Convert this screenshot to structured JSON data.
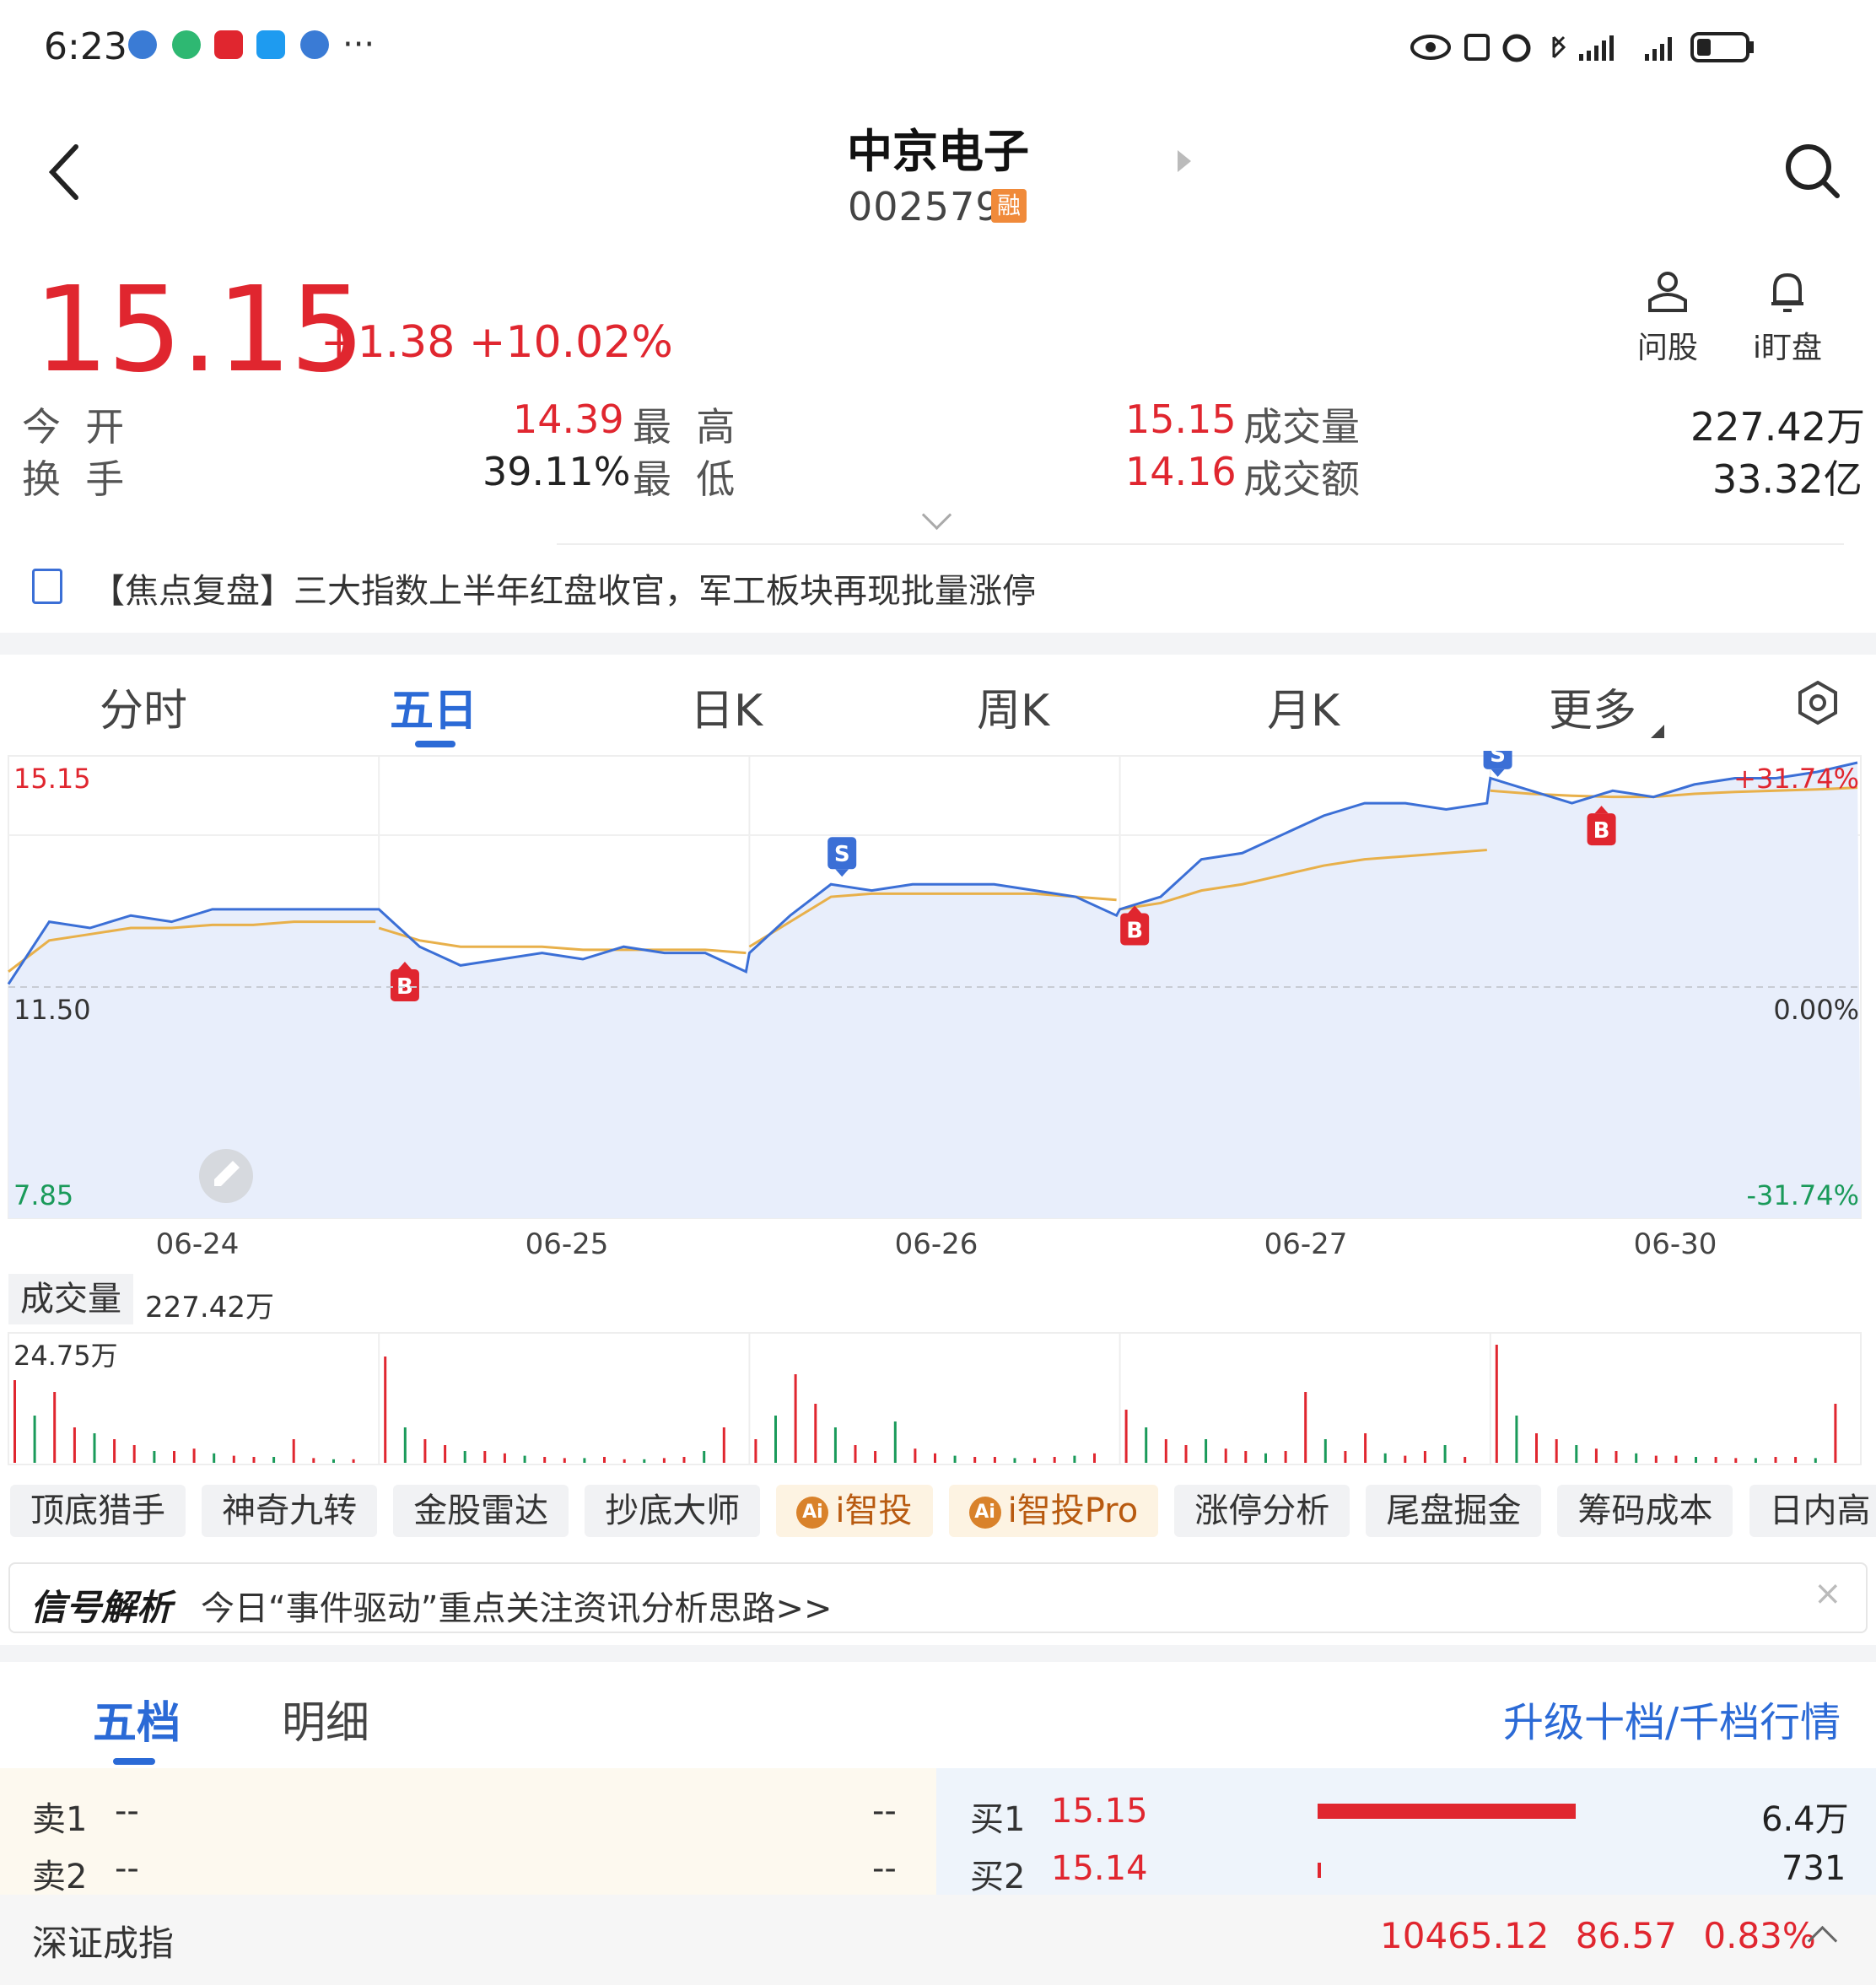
{
  "status_bar": {
    "time": "6:23",
    "more": "···"
  },
  "header": {
    "title": "中京电子",
    "code": "002579",
    "badge": "融"
  },
  "quote": {
    "price": "15.15",
    "change": "+1.38 +10.02%",
    "tools": [
      {
        "label": "问股",
        "icon": "ask-stock-icon"
      },
      {
        "label": "i盯盘",
        "icon": "bell-icon"
      }
    ],
    "stats": [
      {
        "label": "今  开",
        "value": "14.39"
      },
      {
        "label": "最  高",
        "value": "15.15"
      },
      {
        "label": "成交量",
        "value": "227.42万"
      },
      {
        "label": "换  手",
        "value": "39.11%"
      },
      {
        "label": "最  低",
        "value": "14.16"
      },
      {
        "label": "成交额",
        "value": "33.32亿"
      }
    ]
  },
  "news": {
    "text": "【焦点复盘】三大指数上半年红盘收官，军工板块再现批量涨停"
  },
  "chart_tabs": [
    "分时",
    "五日",
    "日K",
    "周K",
    "月K",
    "更多"
  ],
  "active_chart_tab": "五日",
  "chart_data": {
    "type": "line",
    "y_max_label": "15.15",
    "y_mid_label": "11.50",
    "y_min_label": "7.85",
    "pct_max_label": "+31.74%",
    "pct_mid_label": "0.00%",
    "pct_min_label": "-31.74%",
    "ylim": [
      7.85,
      15.15
    ],
    "prev_close": 11.5,
    "days": [
      "06-24",
      "06-25",
      "06-26",
      "06-27",
      "06-30"
    ],
    "series": [
      {
        "type": "price",
        "color": "#3b6fd6",
        "points_per_day": [
          [
            11.6,
            12.6,
            12.5,
            12.7,
            12.6,
            12.8,
            12.8,
            12.8,
            12.8,
            12.8
          ],
          [
            12.8,
            12.2,
            11.9,
            12.0,
            12.1,
            12.0,
            12.2,
            12.1,
            12.1,
            11.8
          ],
          [
            12.1,
            12.7,
            13.2,
            13.1,
            13.2,
            13.2,
            13.2,
            13.1,
            13.0,
            12.7
          ],
          [
            12.8,
            13.0,
            13.6,
            13.7,
            14.0,
            14.3,
            14.5,
            14.5,
            14.4,
            14.5
          ],
          [
            14.9,
            14.7,
            14.5,
            14.7,
            14.6,
            14.8,
            14.9,
            14.9,
            15.0,
            15.15
          ]
        ]
      },
      {
        "type": "average",
        "color": "#e8b04a",
        "points_per_day": [
          [
            11.8,
            12.3,
            12.4,
            12.5,
            12.5,
            12.55,
            12.55,
            12.6,
            12.6,
            12.6
          ],
          [
            12.5,
            12.3,
            12.2,
            12.2,
            12.2,
            12.15,
            12.15,
            12.15,
            12.15,
            12.1
          ],
          [
            12.2,
            12.6,
            13.0,
            13.05,
            13.05,
            13.05,
            13.05,
            13.05,
            13.0,
            12.95
          ],
          [
            12.8,
            12.9,
            13.1,
            13.2,
            13.35,
            13.5,
            13.6,
            13.65,
            13.7,
            13.75
          ],
          [
            14.7,
            14.65,
            14.62,
            14.6,
            14.6,
            14.65,
            14.68,
            14.7,
            14.72,
            14.75
          ]
        ]
      }
    ],
    "markers": [
      {
        "label": "B",
        "day": 1,
        "pos": 0.07,
        "value": 12.0,
        "color": "#e0262f"
      },
      {
        "label": "S",
        "day": 2,
        "pos": 0.25,
        "value": 13.2,
        "color": "#3b6fd6"
      },
      {
        "label": "B",
        "day": 3,
        "pos": 0.04,
        "value": 12.9,
        "color": "#e0262f"
      },
      {
        "label": "S",
        "day": 4,
        "pos": 0.02,
        "value": 14.8,
        "color": "#3b6fd6"
      },
      {
        "label": "B",
        "day": 4,
        "pos": 0.3,
        "value": 14.5,
        "color": "#e0262f"
      }
    ]
  },
  "volume": {
    "label": "成交量",
    "total": "227.42万",
    "max_label": "24.75万",
    "bars_per_day": [
      [
        0.7,
        0.4,
        0.6,
        0.3,
        0.25,
        0.2,
        0.15,
        0.1,
        0.1,
        0.12,
        0.08,
        0.06,
        0.05,
        0.05,
        0.2,
        0.04,
        0.03,
        0.03
      ],
      [
        0.9,
        0.3,
        0.2,
        0.15,
        0.1,
        0.1,
        0.08,
        0.06,
        0.05,
        0.04,
        0.04,
        0.05,
        0.03,
        0.03,
        0.04,
        0.05,
        0.1,
        0.3
      ],
      [
        0.2,
        0.4,
        0.75,
        0.5,
        0.3,
        0.15,
        0.1,
        0.35,
        0.12,
        0.08,
        0.06,
        0.05,
        0.05,
        0.04,
        0.04,
        0.05,
        0.06,
        0.08
      ],
      [
        0.45,
        0.3,
        0.2,
        0.15,
        0.2,
        0.12,
        0.1,
        0.08,
        0.1,
        0.6,
        0.2,
        0.1,
        0.25,
        0.08,
        0.06,
        0.1,
        0.15,
        0.05
      ],
      [
        1.0,
        0.4,
        0.25,
        0.2,
        0.15,
        0.12,
        0.1,
        0.08,
        0.06,
        0.06,
        0.05,
        0.05,
        0.04,
        0.04,
        0.05,
        0.05,
        0.04,
        0.5
      ]
    ]
  },
  "tools": [
    {
      "label": "顶底猎手",
      "ai": false
    },
    {
      "label": "神奇九转",
      "ai": false
    },
    {
      "label": "金股雷达",
      "ai": false
    },
    {
      "label": "抄底大师",
      "ai": false
    },
    {
      "label": "i智投",
      "ai": true
    },
    {
      "label": "i智投Pro",
      "ai": true
    },
    {
      "label": "涨停分析",
      "ai": false
    },
    {
      "label": "尾盘掘金",
      "ai": false
    },
    {
      "label": "筹码成本",
      "ai": false
    },
    {
      "label": "日内高",
      "ai": false
    }
  ],
  "signal": {
    "brand": "信号解析",
    "text": "今日“事件驱动”重点关注资讯分析思路>>",
    "close": "×"
  },
  "order_tabs": [
    "五档",
    "明细"
  ],
  "upgrade": "升级十档/千档行情",
  "sell": [
    {
      "label": "卖1",
      "price": "--",
      "vol": "--"
    },
    {
      "label": "卖2",
      "price": "--",
      "vol": "--"
    }
  ],
  "buy": [
    {
      "label": "买1",
      "price": "15.15",
      "vol": "6.4万",
      "share": 1.0
    },
    {
      "label": "买2",
      "price": "15.14",
      "vol": "731",
      "share": 0.011
    }
  ],
  "index": {
    "name": "深证成指",
    "value": "10465.12",
    "change": "86.57",
    "pct": "0.83%"
  },
  "colors": {
    "up": "#e0262f",
    "down": "#1a9a5a",
    "accent": "#2b6ad6"
  }
}
